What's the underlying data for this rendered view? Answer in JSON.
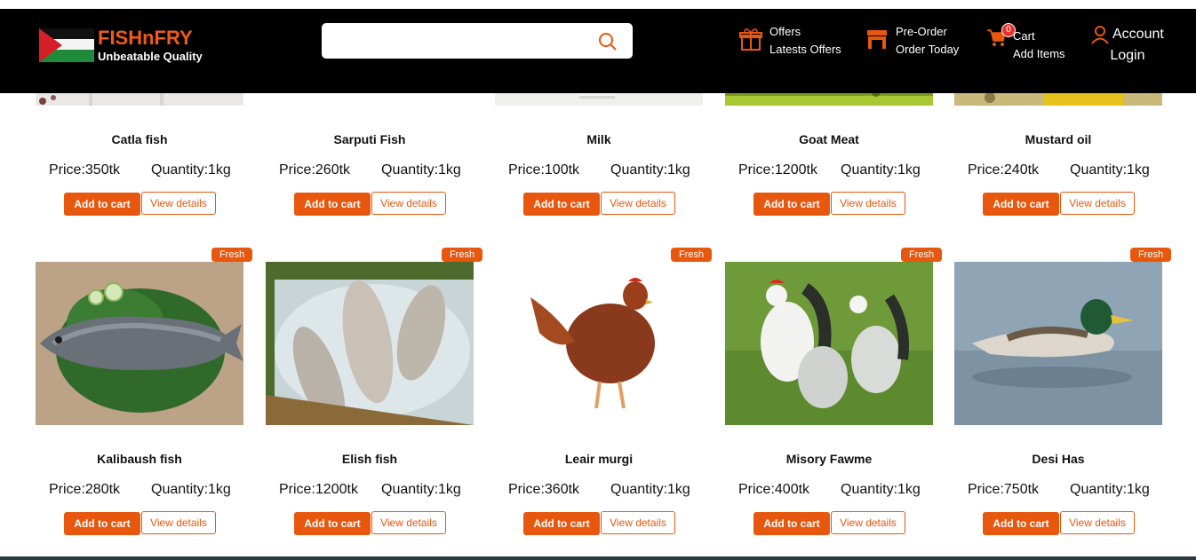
{
  "brand": {
    "name": "FISHnFRY",
    "tagline": "Unbeatable Quality"
  },
  "search": {
    "placeholder": "",
    "value": ""
  },
  "nav": {
    "offers": {
      "line1": "Offers",
      "line2": "Latests Offers"
    },
    "preorder": {
      "line1": "Pre-Order",
      "line2": "Order Today"
    },
    "cart": {
      "line1": "Cart",
      "line2": "Add Items",
      "count": "0"
    },
    "account": {
      "line1": "Account",
      "line2": "Login"
    }
  },
  "buttons": {
    "add": "Add to cart",
    "view": "View details"
  },
  "badge_label": "Fresh",
  "colors": {
    "accent": "#e8570e",
    "navbar": "#000000"
  },
  "row1": [
    {
      "title": "Catla fish",
      "price": "Price:350tk",
      "qty": "Quantity:1kg"
    },
    {
      "title": "Sarputi Fish",
      "price": "Price:260tk",
      "qty": "Quantity:1kg"
    },
    {
      "title": "Milk",
      "price": "Price:100tk",
      "qty": "Quantity:1kg"
    },
    {
      "title": "Goat Meat",
      "price": "Price:1200tk",
      "qty": "Quantity:1kg"
    },
    {
      "title": "Mustard oil",
      "price": "Price:240tk",
      "qty": "Quantity:1kg"
    }
  ],
  "row2": [
    {
      "title": "Kalibaush fish",
      "price": "Price:280tk",
      "qty": "Quantity:1kg",
      "image": "fish-on-leaves"
    },
    {
      "title": "Elish fish",
      "price": "Price:1200tk",
      "qty": "Quantity:1kg",
      "image": "hilsa-on-ice"
    },
    {
      "title": "Leair murgi",
      "price": "Price:360tk",
      "qty": "Quantity:1kg",
      "image": "brown-hen"
    },
    {
      "title": "Misory Fawme",
      "price": "Price:400tk",
      "qty": "Quantity:1kg",
      "image": "chickens-on-grass"
    },
    {
      "title": "Desi Has",
      "price": "Price:750tk",
      "qty": "Quantity:1kg",
      "image": "duck-on-water"
    }
  ]
}
